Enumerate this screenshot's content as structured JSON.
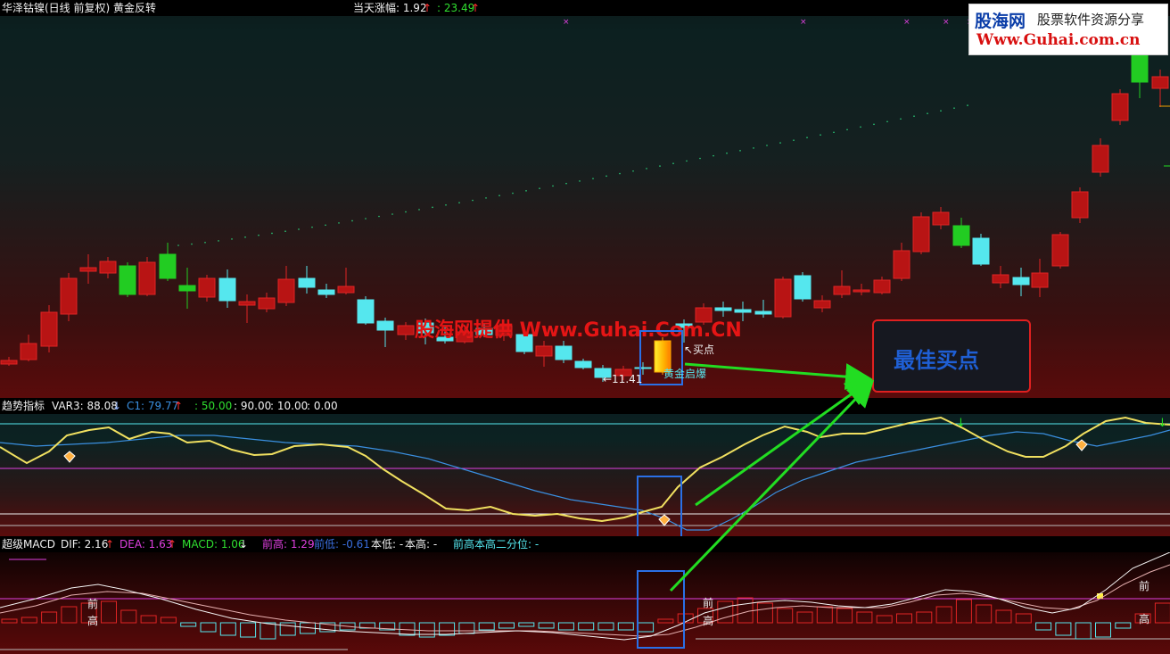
{
  "main": {
    "title": "华泽钴镍(日线 前复权) 黄金反转",
    "rise_label": "当天涨幅: 1.92",
    "rise_arrow": "↑",
    "rise_value": ": 23.49",
    "rise_arrow2": "↑",
    "label_buy_point": "↖买点",
    "label_golden": "黄金启爆",
    "label_low": "←11.41"
  },
  "watermark": {
    "site_name": "股海网",
    "site_slogan": "股票软件资源分享",
    "site_url": "Www.Guhai.com.cn",
    "center_text": "股海网提供 Www.Guhai.Com.CN"
  },
  "annotation": {
    "best_buy": "最佳买点"
  },
  "trend": {
    "name": "趋势指标",
    "var3": "VAR3: 88.08",
    "var3_arrow": "↓",
    "c1": "C1: 79.77",
    "c1_arrow": "↑",
    "l50": ": 50.00",
    "l90": ": 90.00",
    "l10": ": 10.00",
    "l0": ": 0.00"
  },
  "macd": {
    "name": "超级MACD",
    "dif": "DIF: 2.16",
    "dif_arrow": "↑",
    "dea": "DEA: 1.63",
    "dea_arrow": "↑",
    "macd": "MACD: 1.06",
    "macd_arrow": "↓",
    "prev_high": "前高: 1.29",
    "prev_low": "前低: -0.61",
    "this_low": "本低: -",
    "this_high": "本高: -",
    "quantile": "前高本高二分位: -",
    "marker_qian": "前",
    "marker_gao": "高"
  },
  "colors": {
    "up": "#e02424",
    "down": "#55e7ee",
    "green": "#22cc22",
    "yellow_line": "#f0e060",
    "blue_line": "#3a8fe0",
    "magenta": "#e040e0",
    "highlight": "#2a70e6"
  }
}
